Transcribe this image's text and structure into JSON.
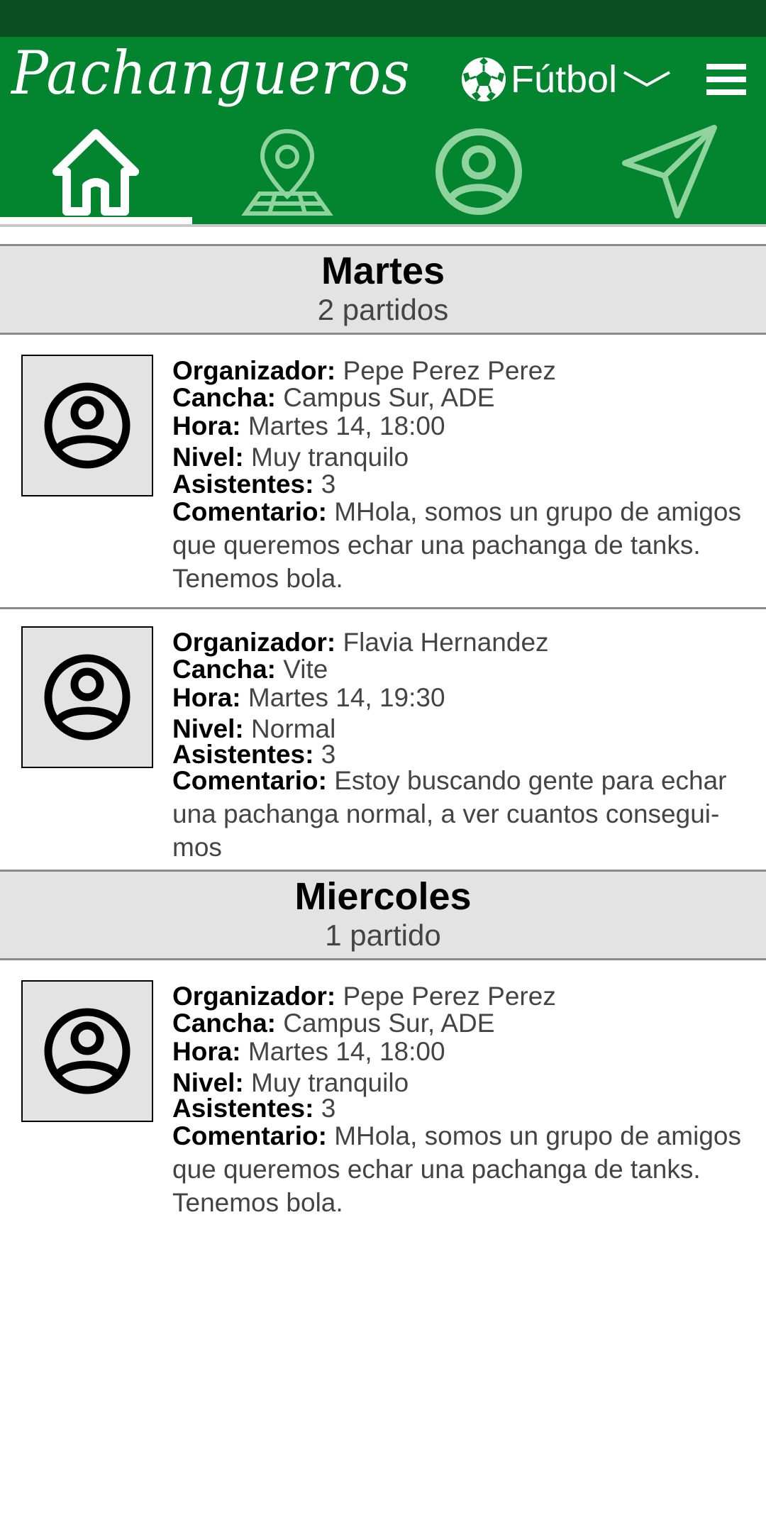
{
  "app": {
    "title": "Pachangueros",
    "sport": "Fútbol"
  },
  "tabs": [
    {
      "icon": "home-icon",
      "active": true
    },
    {
      "icon": "map-pin-icon",
      "active": false
    },
    {
      "icon": "profile-icon",
      "active": false
    },
    {
      "icon": "send-icon",
      "active": false
    }
  ],
  "labels": {
    "organizer": "Organizador:",
    "court": "Cancha:",
    "time": "Hora:",
    "level": "Nivel:",
    "attendees": "Asistentes:",
    "comment": "Comentario:"
  },
  "days": [
    {
      "name": "Martes",
      "count": "2 partidos",
      "matches": [
        {
          "organizer": "Pepe Perez Perez",
          "court": "Campus Sur, ADE",
          "time": "Martes 14, 18:00",
          "level": "Muy tranquilo",
          "attendees": "3",
          "comment": "MHola, somos un grupo de amigos que queremos echar una pachanga de tanks. Tenemos bola."
        },
        {
          "organizer": "Flavia Hernandez",
          "court": "Vite",
          "time": "Martes 14, 19:30",
          "level": "Normal",
          "attendees": "3",
          "comment": "Estoy buscando gente para echar una pachanga normal, a ver cuantos consegui-mos"
        }
      ]
    },
    {
      "name": "Miercoles",
      "count": "1 partido",
      "matches": [
        {
          "organizer": "Pepe Perez Perez",
          "court": "Campus Sur, ADE",
          "time": "Martes 14, 18:00",
          "level": "Muy tranquilo",
          "attendees": "3",
          "comment": "MHola, somos un grupo de amigos que queremos echar una pachanga de tanks. Tenemos bola."
        }
      ]
    }
  ],
  "colors": {
    "header": "#03852f",
    "status_bar": "#0a4d1f",
    "inactive_icon": "#8fd49e",
    "day_bg": "#e3e3e3"
  }
}
